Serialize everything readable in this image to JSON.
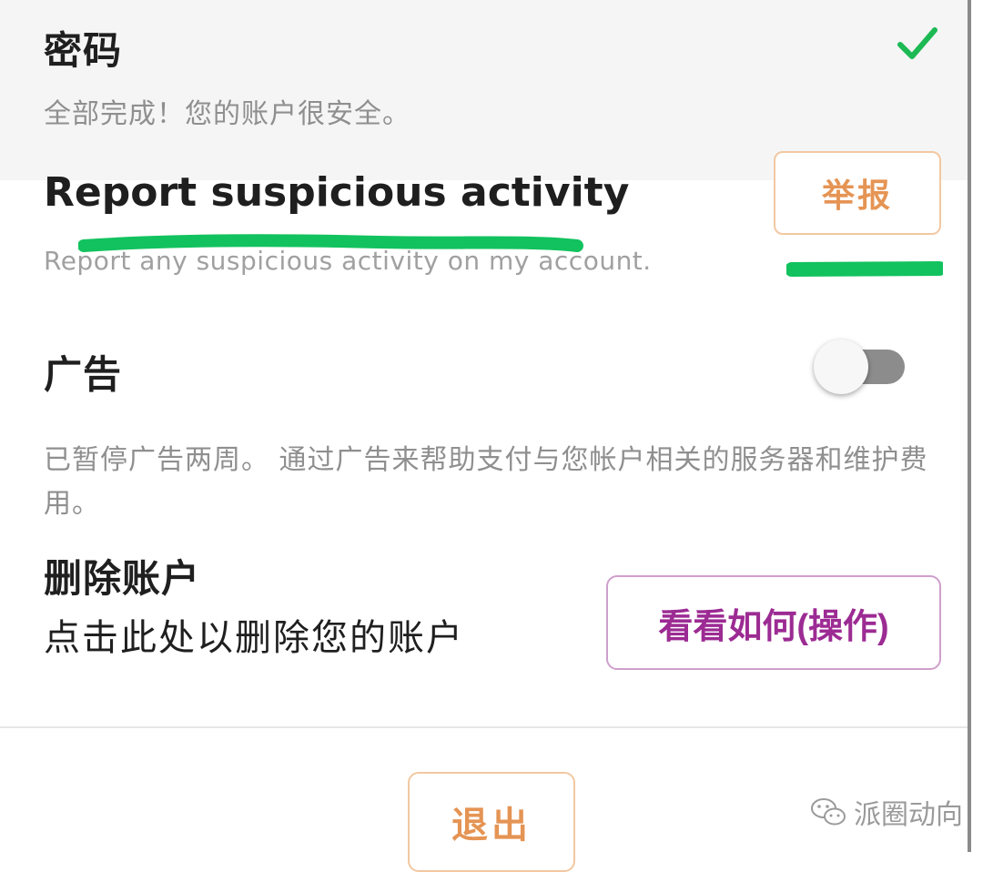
{
  "password": {
    "title": "密码",
    "description": "全部完成！您的账户很安全。",
    "status_icon": "check-icon",
    "status_color": "#1db954"
  },
  "report": {
    "title": "Report suspicious activity",
    "description": "Report any suspicious activity on my account.",
    "button_label": "举报",
    "highlight_color": "#12c25e"
  },
  "ads": {
    "title": "广告",
    "description": "已暂停广告两周。 通过广告来帮助支付与您帐户相关的服务器和维护费用。",
    "toggle_on": false
  },
  "delete_account": {
    "title": "删除账户",
    "description": "点击此处以删除您的账户",
    "button_label": "看看如何(操作)"
  },
  "logout": {
    "button_label": "退出"
  },
  "watermark": {
    "text": "派圈动向",
    "icon": "wechat-icon"
  },
  "colors": {
    "accent_orange": "#e59454",
    "accent_purple": "#9c2b93",
    "check_green": "#1db954"
  }
}
